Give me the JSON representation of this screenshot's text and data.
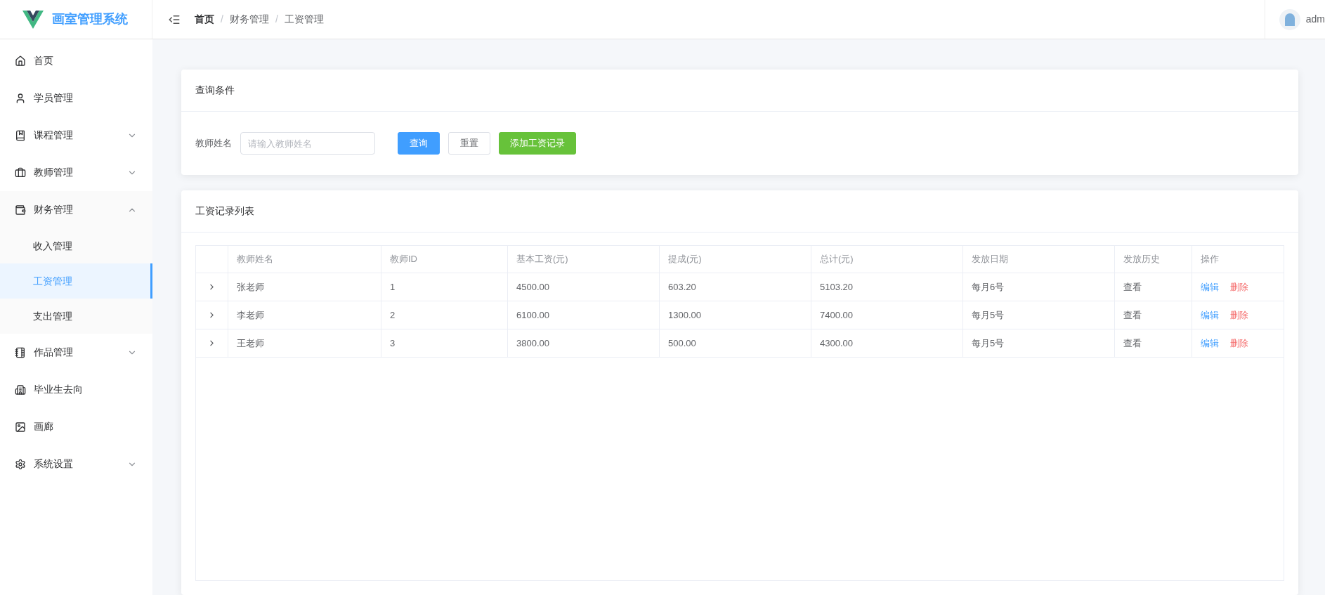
{
  "app": {
    "title": "画室管理系统"
  },
  "breadcrumb": [
    {
      "kind": "link",
      "text": "首页"
    },
    {
      "kind": "separator",
      "text": "/"
    },
    {
      "kind": "link",
      "text": "财务管理"
    },
    {
      "kind": "separator",
      "text": "/"
    },
    {
      "kind": "link",
      "text": "工资管理"
    }
  ],
  "user": {
    "name": "adm"
  },
  "sidebar": {
    "items": [
      {
        "label": "首页",
        "kind": "link"
      },
      {
        "label": "学员管理",
        "kind": "link"
      },
      {
        "label": "课程管理",
        "kind": "group",
        "expanded": false
      },
      {
        "label": "教师管理",
        "kind": "group",
        "expanded": false
      },
      {
        "label": "财务管理",
        "kind": "group",
        "expanded": true,
        "children": [
          {
            "label": "收入管理",
            "selected": false
          },
          {
            "label": "工资管理",
            "selected": true
          },
          {
            "label": "支出管理",
            "selected": false
          }
        ]
      },
      {
        "label": "作品管理",
        "kind": "group",
        "expanded": false
      },
      {
        "label": "毕业生去向",
        "kind": "link"
      },
      {
        "label": "画廊",
        "kind": "link"
      },
      {
        "label": "系统设置",
        "kind": "group",
        "expanded": false
      }
    ]
  },
  "query_card": {
    "title": "查询条件",
    "field_label": "教师姓名",
    "placeholder": "请输入教师姓名",
    "buttons": [
      {
        "label": "查询",
        "kind": "primary"
      },
      {
        "label": "重置",
        "kind": "default"
      },
      {
        "label": "添加工资记录",
        "kind": "success"
      }
    ]
  },
  "table_card": {
    "title": "工资记录列表",
    "columns": [
      "教师姓名",
      "教师ID",
      "基本工资(元)",
      "提成(元)",
      "总计(元)",
      "发放日期",
      "发放历史",
      "操作"
    ],
    "rows": [
      {
        "name": "张老师",
        "id": "1",
        "base": "4500.00",
        "commission": "603.20",
        "total": "5103.20",
        "date": "每月6号",
        "history": "查看",
        "edit": "编辑",
        "delete": "删除"
      },
      {
        "name": "李老师",
        "id": "2",
        "base": "6100.00",
        "commission": "1300.00",
        "total": "7400.00",
        "date": "每月5号",
        "history": "查看",
        "edit": "编辑",
        "delete": "删除"
      },
      {
        "name": "王老师",
        "id": "3",
        "base": "3800.00",
        "commission": "500.00",
        "total": "4300.00",
        "date": "每月5号",
        "history": "查看",
        "edit": "编辑",
        "delete": "删除"
      }
    ]
  }
}
